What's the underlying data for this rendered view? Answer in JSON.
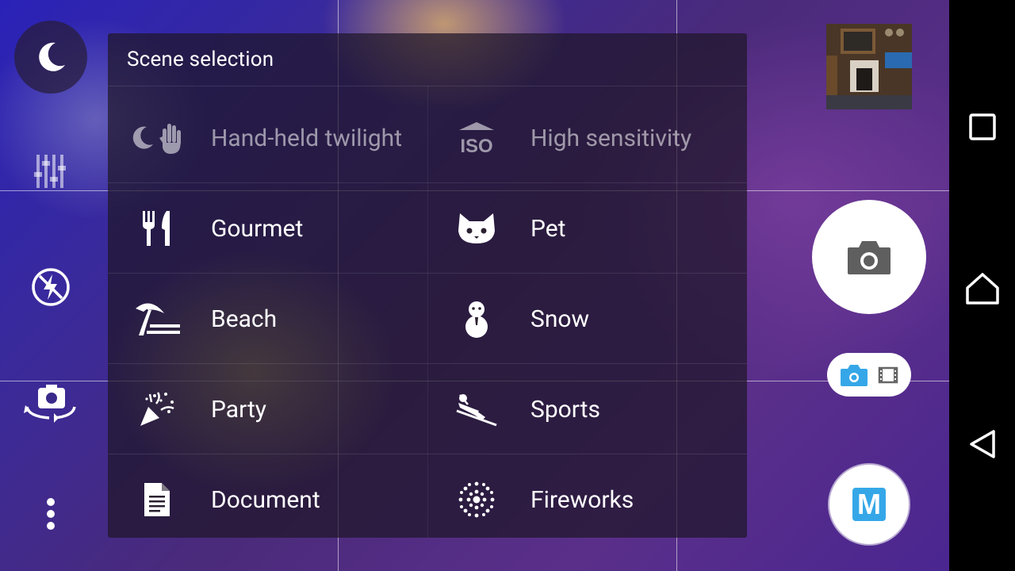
{
  "scene_panel": {
    "title": "Scene selection",
    "items": [
      {
        "label": "Hand-held twilight",
        "icon": "moon-hand-icon",
        "enabled": false
      },
      {
        "label": "High sensitivity",
        "icon": "iso-icon",
        "enabled": false
      },
      {
        "label": "Gourmet",
        "icon": "fork-knife-icon",
        "enabled": true
      },
      {
        "label": "Pet",
        "icon": "cat-face-icon",
        "enabled": true
      },
      {
        "label": "Beach",
        "icon": "palm-tree-icon",
        "enabled": true
      },
      {
        "label": "Snow",
        "icon": "snowman-icon",
        "enabled": true
      },
      {
        "label": "Party",
        "icon": "party-popper-icon",
        "enabled": true
      },
      {
        "label": "Sports",
        "icon": "skier-icon",
        "enabled": true
      },
      {
        "label": "Document",
        "icon": "document-icon",
        "enabled": true
      },
      {
        "label": "Fireworks",
        "icon": "fireworks-icon",
        "enabled": true
      }
    ]
  },
  "left_toolbar": {
    "scene_button_icon": "moon-icon",
    "settings_icon": "sliders-icon",
    "flash_icon": "flash-off-icon",
    "switch_camera_icon": "switch-camera-icon",
    "more_icon": "more-vert-icon"
  },
  "right_controls": {
    "shutter_icon": "camera-icon",
    "mode_toggle": [
      "camera-icon",
      "video-icon"
    ],
    "mode_badge": "M",
    "accent_color": "#35a7e8"
  },
  "nav": {
    "recents_icon": "recents-icon",
    "home_icon": "home-icon",
    "back_icon": "back-icon"
  }
}
